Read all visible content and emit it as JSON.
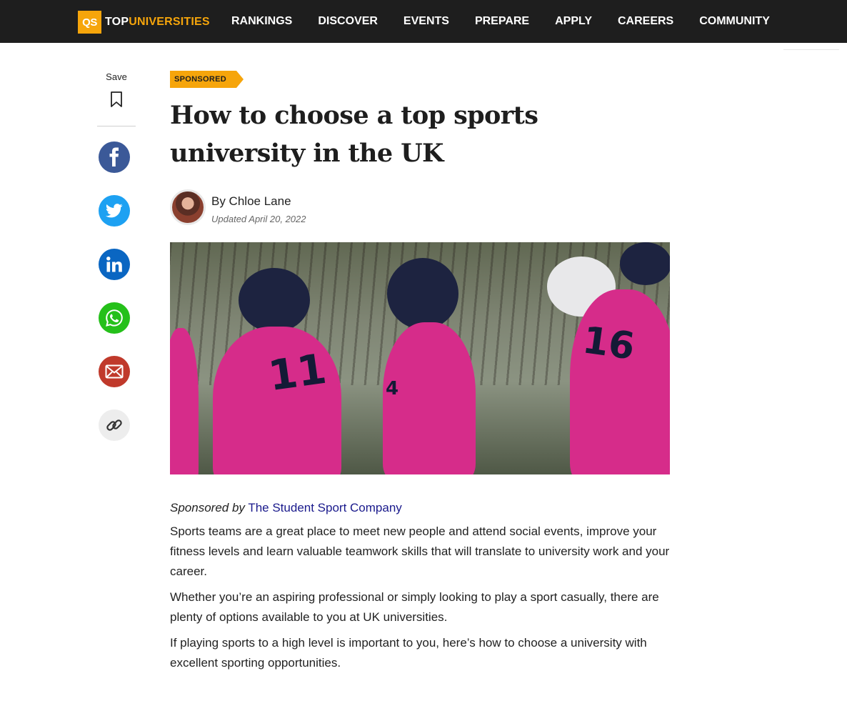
{
  "nav": {
    "logo_badge": "QS",
    "logo_top": "TOP",
    "logo_universities": "UNIVERSITIES",
    "items": [
      "RANKINGS",
      "DISCOVER",
      "EVENTS",
      "PREPARE",
      "APPLY",
      "CAREERS",
      "COMMUNITY"
    ]
  },
  "share_rail": {
    "save_label": "Save",
    "icons": [
      "bookmark-icon",
      "facebook-icon",
      "twitter-icon",
      "linkedin-icon",
      "whatsapp-icon",
      "email-icon",
      "link-icon"
    ]
  },
  "article": {
    "badge": "SPONSORED",
    "title": "How to choose a top sports university in the UK",
    "byline": "By Chloe Lane",
    "updated": "Updated April 20, 2022",
    "sponsor_prefix": "Sponsored by",
    "sponsor_name": "The Student Sport Company",
    "paragraphs": [
      "Sports teams are a great place to meet new people and attend social events, improve your fitness levels and learn valuable teamwork skills that will translate to university work and your career.",
      "Whether you’re an aspiring professional or simply looking to play a sport casually, there are plenty of options available to you at UK universities.",
      "If playing sports to a high level is important to you, here’s how to choose a university with excellent sporting opportunities."
    ],
    "hero_numbers": [
      "11",
      "4",
      "16"
    ]
  },
  "colors": {
    "nav_bg": "#1e1e1e",
    "brand_orange": "#f6a50b",
    "facebook": "#3b5998",
    "twitter": "#1da1f2",
    "linkedin": "#0a66c2",
    "whatsapp": "#25c01a",
    "email": "#c0392b",
    "link_text": "#1a1a8c"
  }
}
